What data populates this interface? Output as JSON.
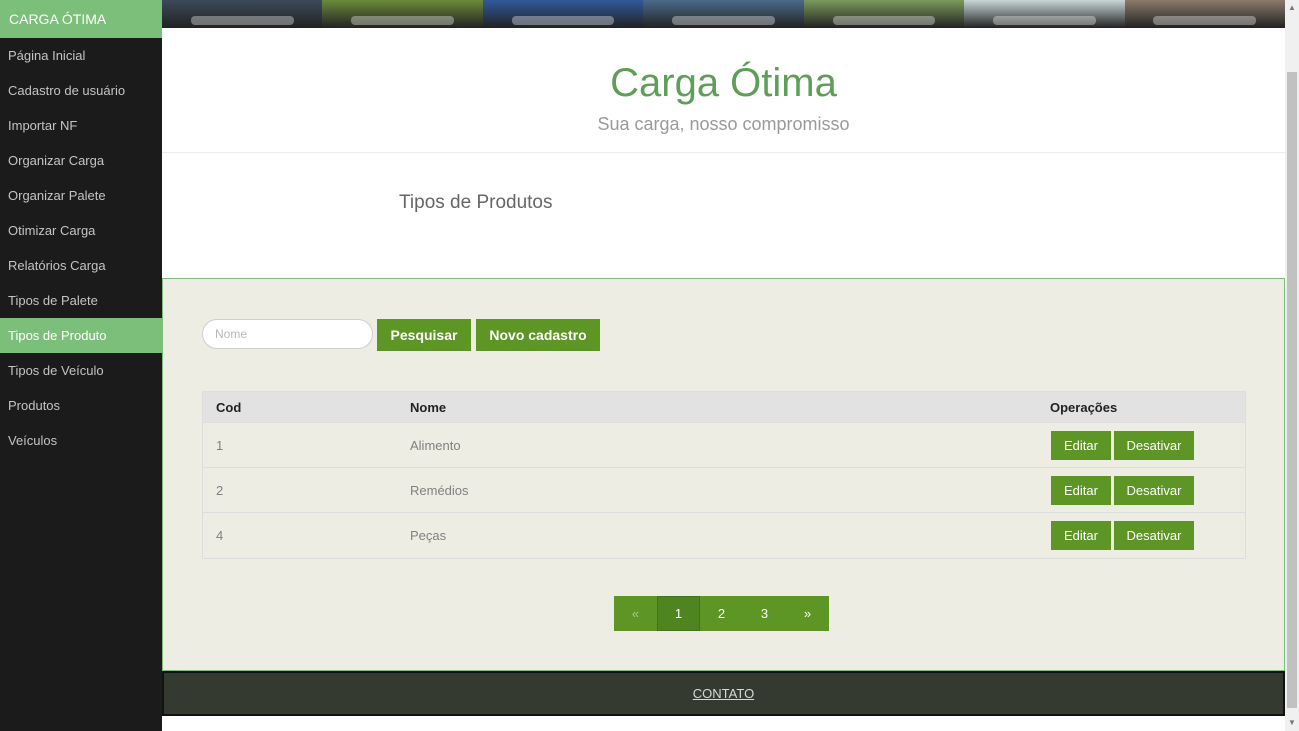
{
  "sidebar": {
    "brand": "CARGA ÓTIMA",
    "items": [
      {
        "label": "Página Inicial"
      },
      {
        "label": "Cadastro de usuário"
      },
      {
        "label": "Importar NF"
      },
      {
        "label": "Organizar Carga"
      },
      {
        "label": "Organizar Palete"
      },
      {
        "label": "Otimizar Carga"
      },
      {
        "label": "Relatórios Carga"
      },
      {
        "label": "Tipos de Palete"
      },
      {
        "label": "Tipos de Produto",
        "active": true
      },
      {
        "label": "Tipos de Veículo"
      },
      {
        "label": "Produtos"
      },
      {
        "label": "Veículos"
      }
    ]
  },
  "banner": {
    "tiles": [
      "#3b4a5a",
      "#6b8a3a",
      "#2f5a9a",
      "#4a6a8a",
      "#7a9a5a",
      "#c9d6d6",
      "#8a7a6a"
    ]
  },
  "header": {
    "title": "Carga Ótima",
    "subtitle": "Sua carga, nosso compromisso"
  },
  "section": {
    "title": "Tipos de Produtos"
  },
  "search": {
    "placeholder": "Nome",
    "value": "",
    "search_label": "Pesquisar",
    "new_label": "Novo cadastro"
  },
  "table": {
    "headers": {
      "cod": "Cod",
      "nome": "Nome",
      "ops": "Operações"
    },
    "rows": [
      {
        "cod": "1",
        "nome": "Alimento",
        "edit": "Editar",
        "deactivate": "Desativar"
      },
      {
        "cod": "2",
        "nome": "Remédios",
        "edit": "Editar",
        "deactivate": "Desativar"
      },
      {
        "cod": "4",
        "nome": "Peças",
        "edit": "Editar",
        "deactivate": "Desativar"
      }
    ]
  },
  "pagination": {
    "prev": "«",
    "pages": [
      "1",
      "2",
      "3"
    ],
    "current": "1",
    "next": "»"
  },
  "footer": {
    "contact": "CONTATO"
  },
  "colors": {
    "accent": "#7cbf7a",
    "button": "#5e9625",
    "sidebar": "#1b1b1b",
    "panel": "#eeede4",
    "footer": "#343a30"
  },
  "icons": {
    "scroll_up": "scroll-up-arrow-icon",
    "scroll_down": "scroll-down-arrow-icon"
  }
}
